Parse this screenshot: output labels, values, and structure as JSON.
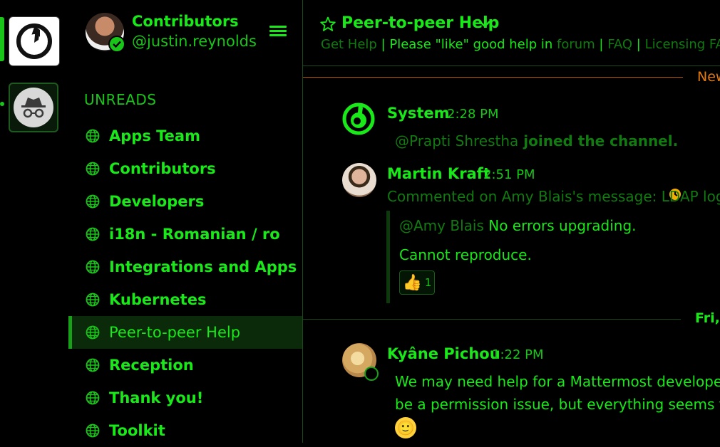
{
  "team": {
    "name": "Contributors",
    "username": "@justin.reynolds"
  },
  "sidebar": {
    "section_title": "UNREADS",
    "channels": [
      {
        "label": "Apps Team",
        "active": false
      },
      {
        "label": "Contributors",
        "active": false
      },
      {
        "label": "Developers",
        "active": false
      },
      {
        "label": "i18n - Romanian / ro",
        "active": false
      },
      {
        "label": "Integrations and Apps",
        "active": false
      },
      {
        "label": "Kubernetes",
        "active": false
      },
      {
        "label": "Peer-to-peer Help",
        "active": true
      },
      {
        "label": "Reception",
        "active": false
      },
      {
        "label": "Thank you!",
        "active": false
      },
      {
        "label": "Toolkit",
        "active": false
      }
    ]
  },
  "header": {
    "title": "Peer-to-peer Help",
    "purpose": {
      "link1": "Get Help",
      "sep1": " | Please \"like\" good help in ",
      "link2": "forum",
      "sep2": " | ",
      "link3": "FAQ",
      "sep3": " | ",
      "link4": "Licensing FAQ",
      "sep4": " |"
    }
  },
  "separators": {
    "new": "New",
    "date": "Fri, J"
  },
  "posts": {
    "system": {
      "author": "System",
      "time": "2:28 PM",
      "mention": "@Prapti Shrestha",
      "text": " joined the channel."
    },
    "martin": {
      "author": "Martin Kraft",
      "time": "2:51 PM",
      "comment_prefix": "Commented on ",
      "comment_user": "Amy Blais",
      "comment_mid": "'s message: ",
      "comment_link": "LDAP login st",
      "reply1_mention": "@Amy Blais",
      "reply1_text": " No errors upgrading.",
      "reply2_text": "Cannot reproduce.",
      "reaction_emoji": "👍",
      "reaction_count": "1"
    },
    "kyane": {
      "author": "Kyâne Pichou",
      "time": "1:22 PM",
      "line1": "We may need help for a Mattermost developer to",
      "line2": "be a permission issue, but everything seems to b",
      "emoji": "🙂"
    }
  },
  "icons": {
    "team_logo": "mattermost-logo-icon",
    "incognito": "incognito-icon",
    "globe": "globe-icon",
    "menu": "hamburger-icon",
    "star": "star-icon",
    "chevron": "chevron-down-icon",
    "away": "away-clock-icon"
  },
  "colors": {
    "accent": "#19e819",
    "muted": "#117a11",
    "new_line": "#e07a10",
    "background": "#000000"
  }
}
